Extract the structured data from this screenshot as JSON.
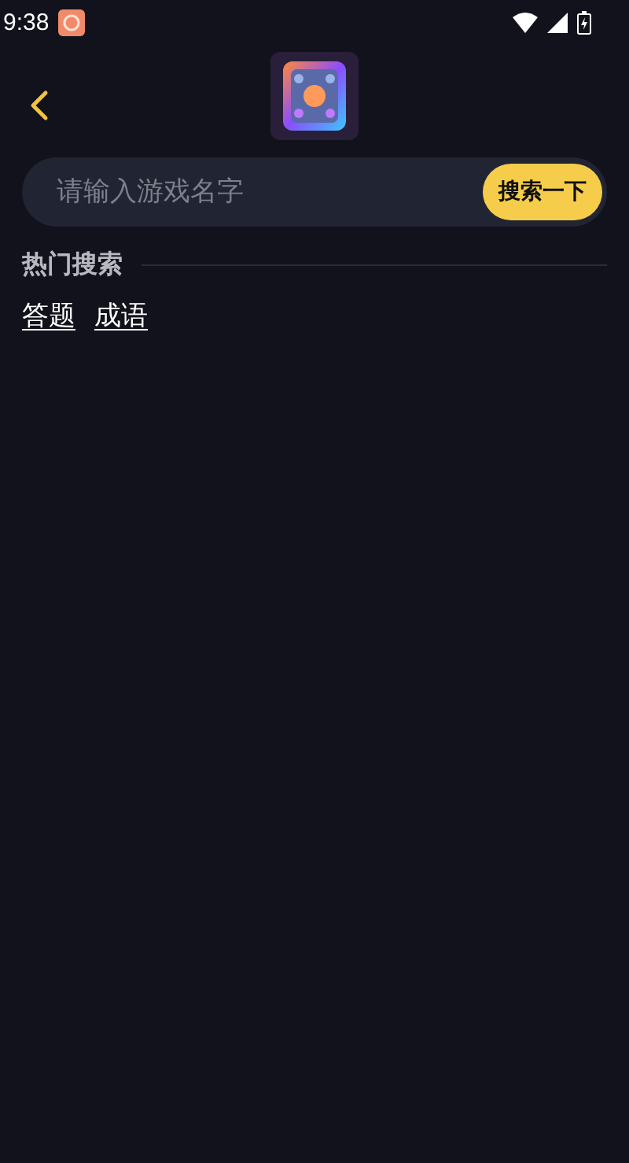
{
  "status_bar": {
    "time": "9:38"
  },
  "search": {
    "placeholder": "请输入游戏名字",
    "button": "搜索一下"
  },
  "hot_search": {
    "title": "热门搜索",
    "tags": [
      "答题",
      "成语"
    ]
  }
}
